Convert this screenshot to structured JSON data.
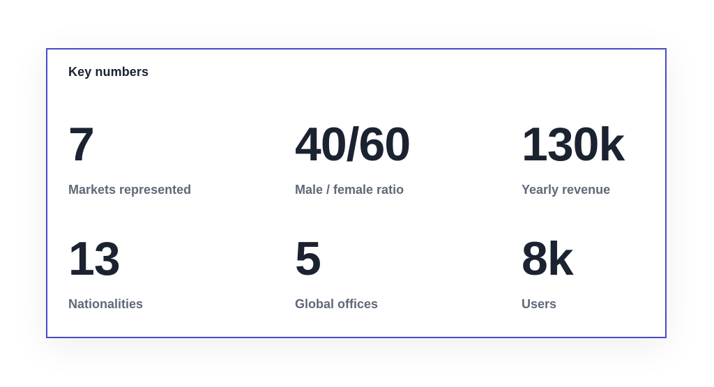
{
  "card": {
    "title": "Key numbers",
    "stats": [
      {
        "value": "7",
        "label": "Markets represented"
      },
      {
        "value": "40/60",
        "label": "Male / female ratio"
      },
      {
        "value": "130k",
        "label": "Yearly revenue"
      },
      {
        "value": "13",
        "label": "Nationalities"
      },
      {
        "value": "5",
        "label": "Global offices"
      },
      {
        "value": "8k",
        "label": "Users"
      }
    ]
  },
  "colors": {
    "border": "#4a4ac7",
    "value_text": "#1b2230",
    "label_text": "#606878"
  }
}
